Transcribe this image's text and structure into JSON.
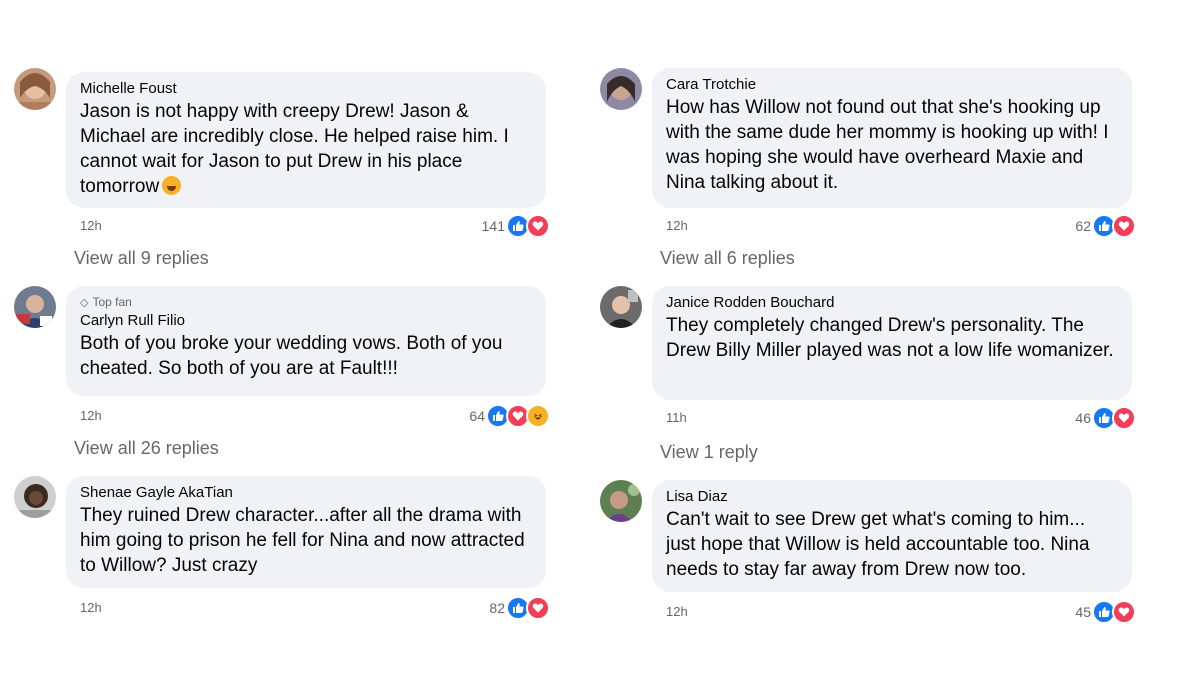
{
  "comments": {
    "c1": {
      "name": "Michelle Foust",
      "text": "Jason is not happy with creepy Drew! Jason & Michael are incredibly close. He helped raise him. I cannot wait for Jason to put Drew in his place tomorrow",
      "time": "12h",
      "count": "141",
      "replies": "View all 9 replies"
    },
    "c2": {
      "badge": "Top fan",
      "name": "Carlyn Rull Filio",
      "text": "Both of you broke your wedding vows. Both of you cheated. So both of you are at Fault!!!",
      "time": "12h",
      "count": "64",
      "replies": "View all 26 replies"
    },
    "c3": {
      "name": "Shenae Gayle AkaTian",
      "text": "They ruined Drew character...after all the drama with him going to prison he fell for Nina and now attracted to Willow? Just crazy",
      "time": "12h",
      "count": "82"
    },
    "c4": {
      "name": "Cara Trotchie",
      "text": "How has Willow not found out that she's hooking up with the same dude her mommy is hooking up with! I was hoping she would have overheard Maxie and Nina talking about it.",
      "time": "12h",
      "count": "62",
      "replies": "View all 6 replies"
    },
    "c5": {
      "name": "Janice Rodden Bouchard",
      "text": "They completely changed Drew's personality. The Drew Billy Miller played was not a low life womanizer.",
      "time": "11h",
      "count": "46",
      "replies": "View 1 reply"
    },
    "c6": {
      "name": "Lisa Diaz",
      "text": "Can't wait to see Drew get what's coming to him... just hope that Willow is held accountable too. Nina needs to stay far away from Drew now too.",
      "time": "12h",
      "count": "45"
    }
  },
  "colors": {
    "like": "#1877f2",
    "love": "#f33e58",
    "haha": "#f7b125",
    "bubble": "#f0f2f5",
    "meta": "#65676b"
  },
  "icons": {
    "like": "thumbs-up-icon",
    "love": "heart-icon",
    "haha": "haha-emoji-icon",
    "badge": "diamond-icon"
  }
}
